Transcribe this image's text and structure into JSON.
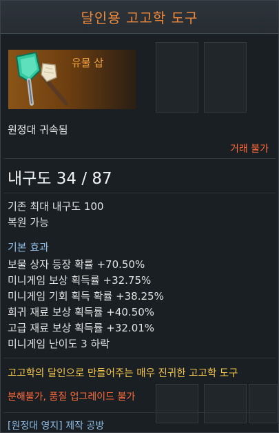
{
  "title": "달인용 고고학 도구",
  "grade": "유물 삽",
  "bound": "원정대 귀속됨",
  "trade": "거래 불가",
  "durability": "내구도 34 / 87",
  "max_durability": "기존 최대 내구도 100",
  "repairable": "복원 가능",
  "section_title": "기본 효과",
  "effects": [
    "보물 상자 등장 확률 +70.50%",
    "미니게임 보상 획득률 +32.75%",
    "미니게임 기회 획득 확률 +38.25%",
    "희귀 재료 보상 획득률 +40.50%",
    "고급 재료 보상 획득률 +32.01%",
    "미니게임 난이도 3 하락"
  ],
  "description": "고고학의 달인으로 만들어주는 매우 진귀한 고고학 도구",
  "restrictions": "분해불가, 품질 업그레이드 불가",
  "source": "[원정대 영지] 제작 공방",
  "colors": {
    "title": "#f08a3a",
    "grade": "#f0a040",
    "warning": "#ff6a3b",
    "section": "#8fbde6",
    "description": "#f3c64a"
  }
}
